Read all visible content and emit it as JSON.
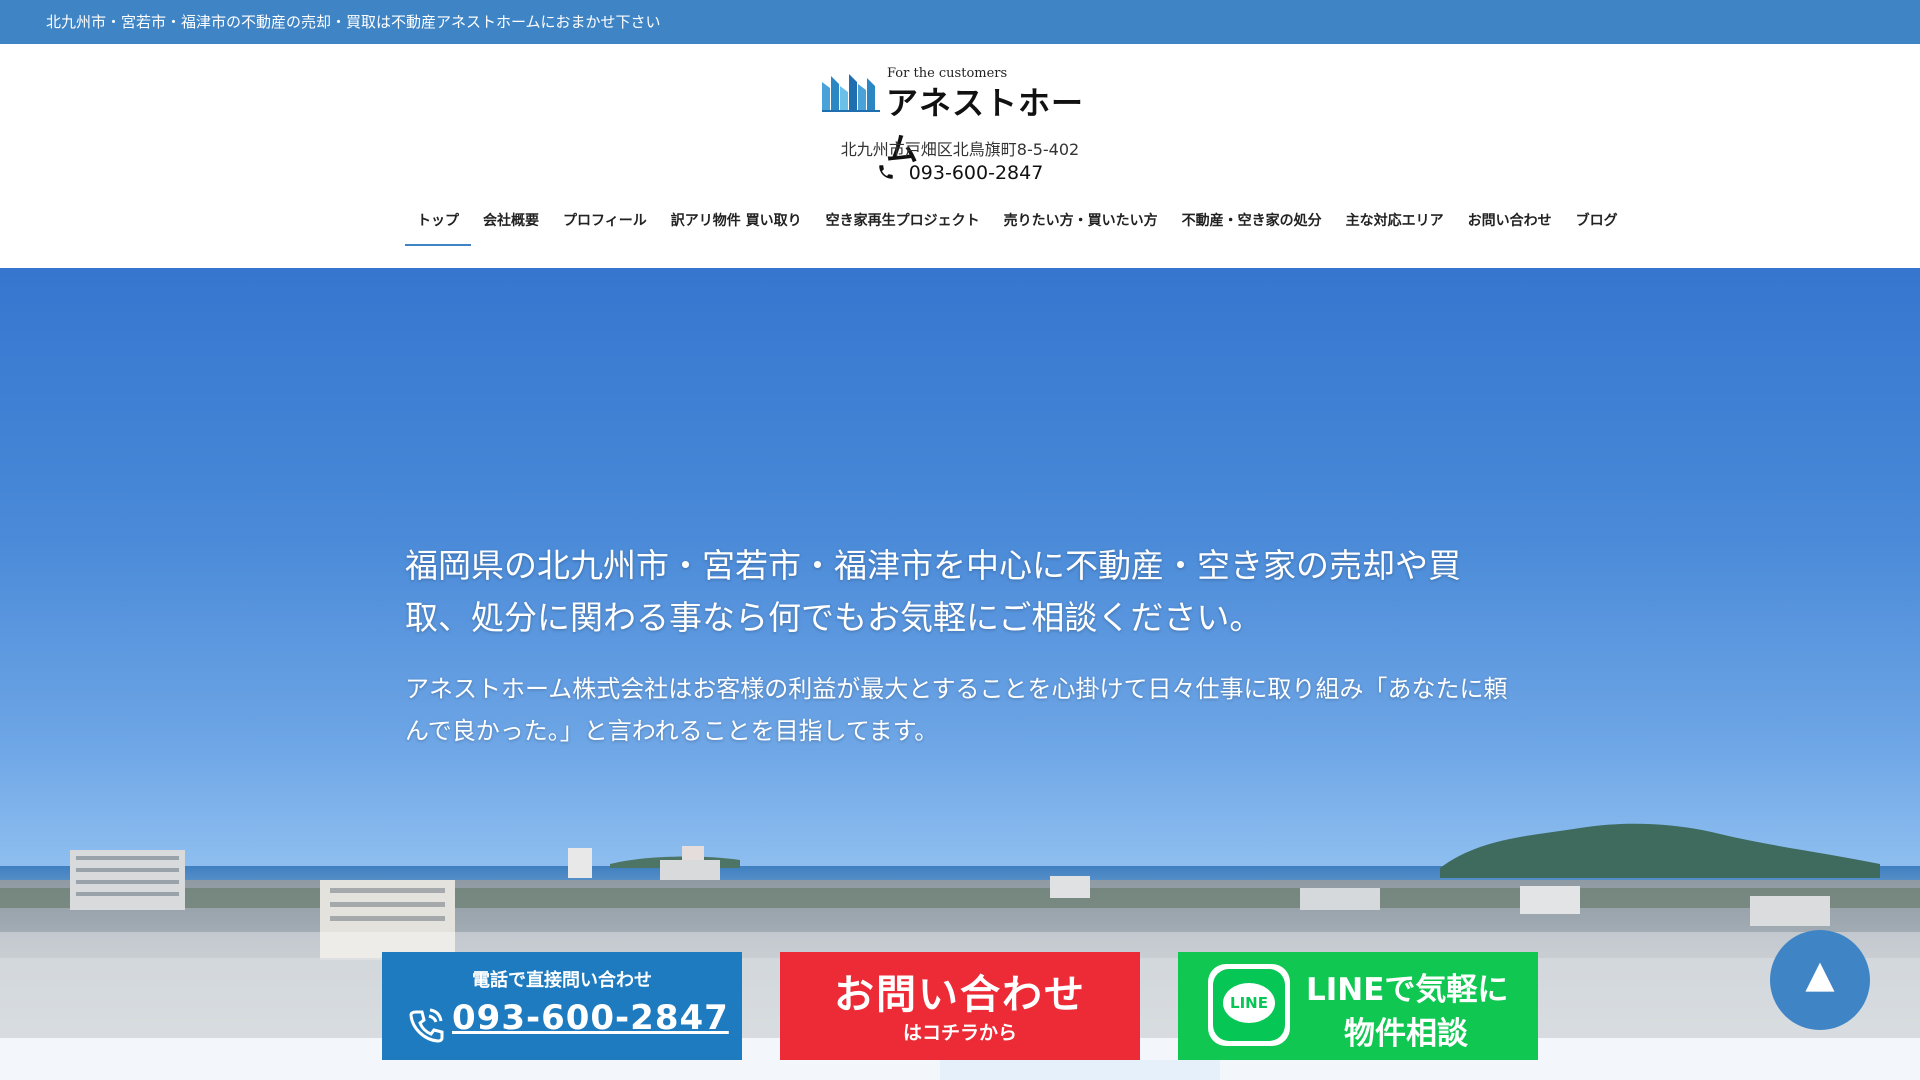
{
  "topbar": {
    "text": "北九州市・宮若市・福津市の不動産の売却・買取は不動産アネストホームにおまかせ下さい"
  },
  "header": {
    "logo_sub": "For the customers",
    "logo_name": "アネストホーム",
    "address": "北九州市戸畑区北鳥旗町8-5-402",
    "phone": "093-600-2847"
  },
  "nav": {
    "items": [
      {
        "label": "トップ"
      },
      {
        "label": "会社概要"
      },
      {
        "label": "プロフィール"
      },
      {
        "label": "訳アリ物件 買い取り"
      },
      {
        "label": "空き家再生プロジェクト"
      },
      {
        "label": "売りたい方・買いたい方"
      },
      {
        "label": "不動産・空き家の処分"
      },
      {
        "label": "主な対応エリア"
      },
      {
        "label": "お問い合わせ"
      },
      {
        "label": "ブログ"
      }
    ]
  },
  "hero": {
    "headline": "福岡県の北九州市・宮若市・福津市を中心に不動産・空き家の売却や買取、処分に関わる事なら何でもお気軽にご相談ください。",
    "body": "アネストホーム株式会社はお客様の利益が最大とすることを心掛けて日々仕事に取り組み「あなたに頼んで良かった。」と言われることを目指してます。"
  },
  "cta": {
    "phone_small": "電話で直接問い合わせ",
    "phone_number": "093-600-2847",
    "contact_big": "お問い合わせ",
    "contact_small": "はコチラから",
    "line_badge": "LINE",
    "line_line1": "LINEで気軽に",
    "line_line2": "物件相談"
  },
  "to_top": {
    "glyph": "▲"
  },
  "colors": {
    "topbar": "#3f85c6",
    "cta_phone": "#1e7bbf",
    "cta_contact": "#ec2b37",
    "cta_line": "#10c752",
    "to_top": "#3f85c6"
  },
  "icons": [
    "building-logo-icon",
    "phone-icon",
    "handset-icon",
    "line-icon",
    "arrow-up-icon"
  ]
}
